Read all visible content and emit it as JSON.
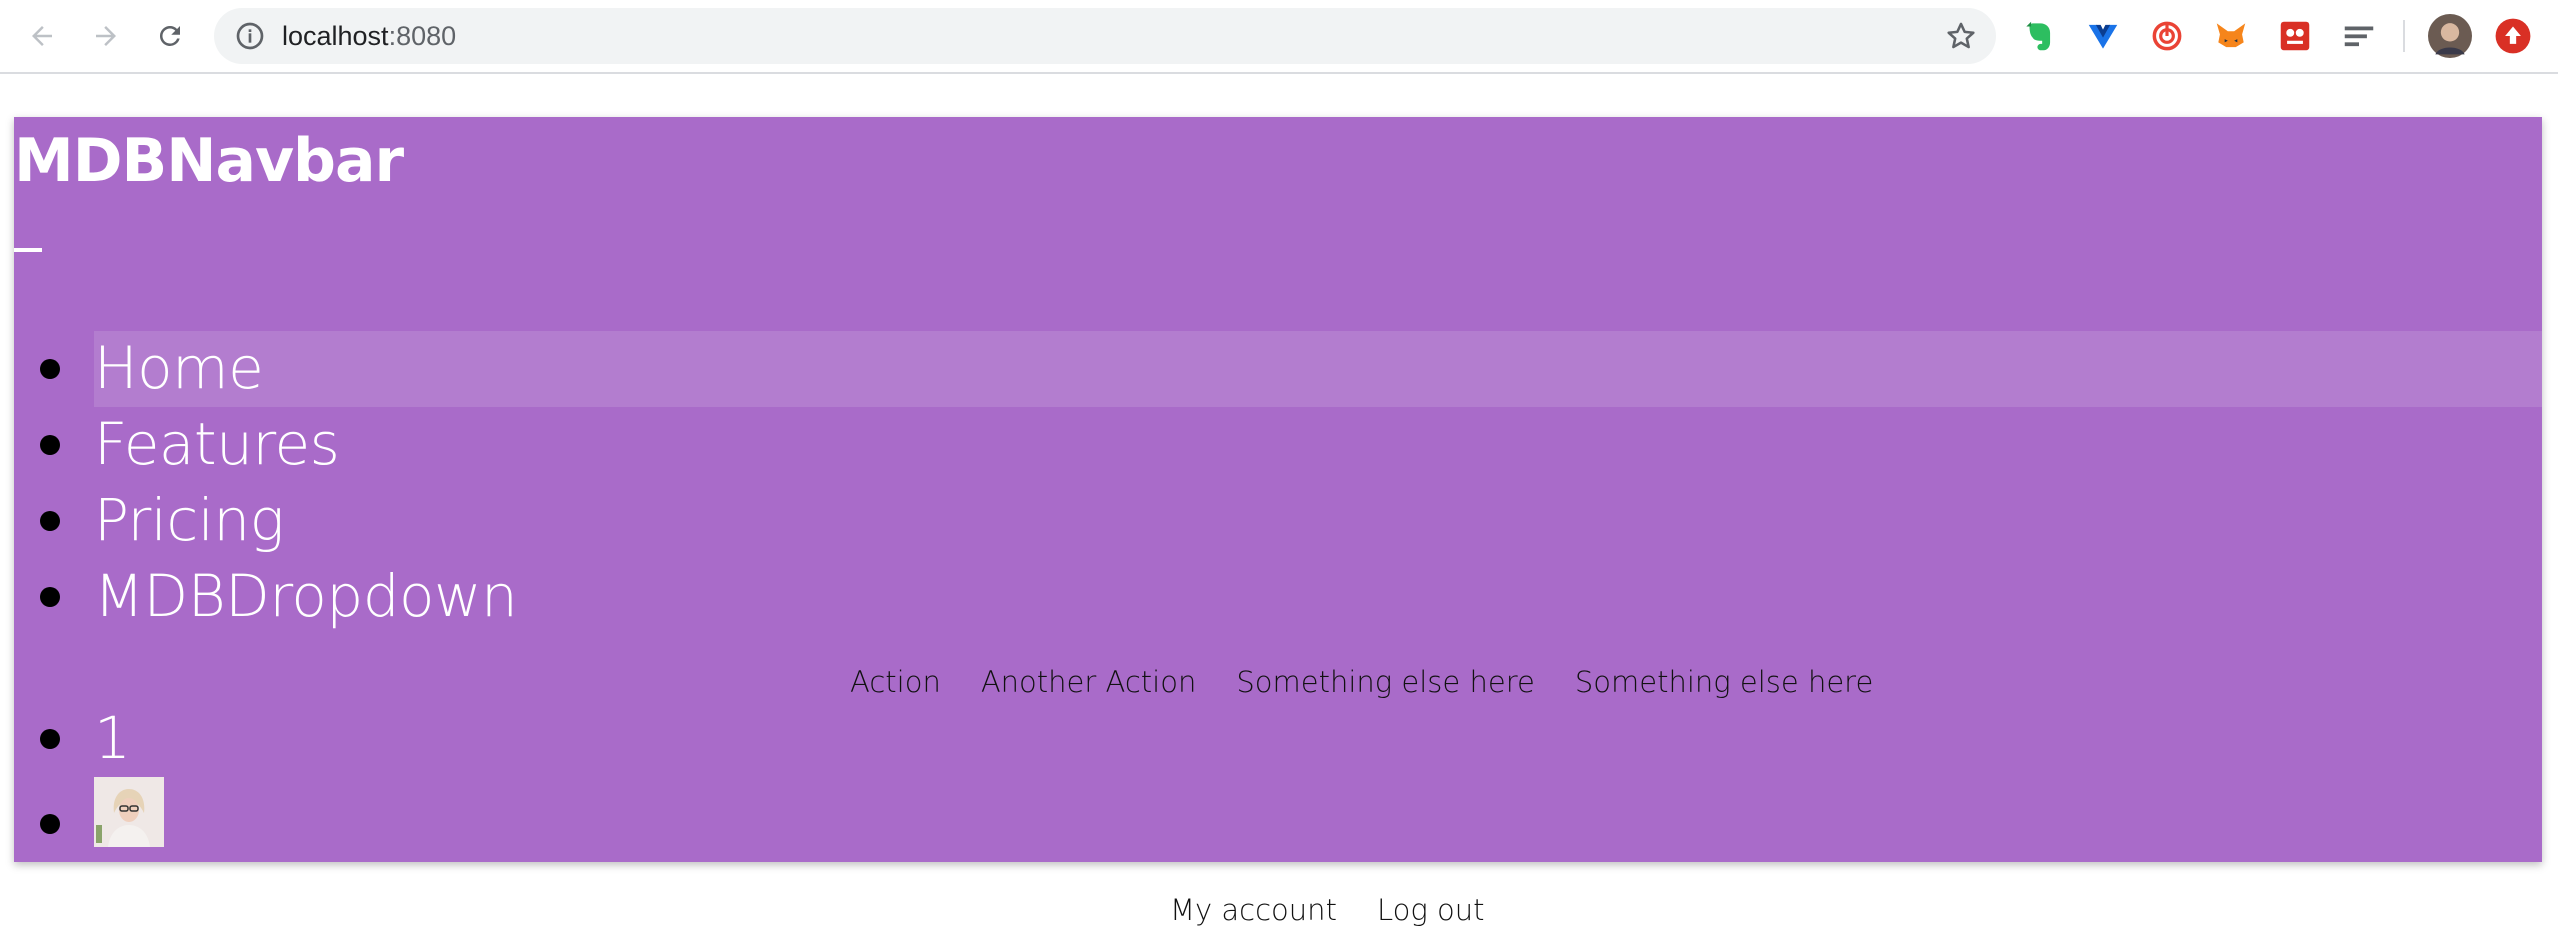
{
  "browser": {
    "url_host": "localhost",
    "url_port": ":8080",
    "extensions": [
      "evernote-icon",
      "vuejs-devtools-icon",
      "lastpass-like-icon",
      "metamask-icon",
      "red-extension-icon",
      "reader-icon"
    ],
    "colors": {
      "chrome_bg": "#ffffff",
      "omnibox_bg": "#f1f3f4"
    }
  },
  "navbar": {
    "brand": "MDBNavbar",
    "color": "#a96bc9",
    "items": [
      {
        "label": "Home",
        "active": true
      },
      {
        "label": "Features",
        "active": false
      },
      {
        "label": "Pricing",
        "active": false
      },
      {
        "label": "MDBDropdown",
        "active": false
      }
    ],
    "dropdown_items": [
      "Action",
      "Another Action",
      "Something else here",
      "Something else here"
    ],
    "badge_item": "1",
    "account_items": [
      "My account",
      "Log out"
    ]
  }
}
